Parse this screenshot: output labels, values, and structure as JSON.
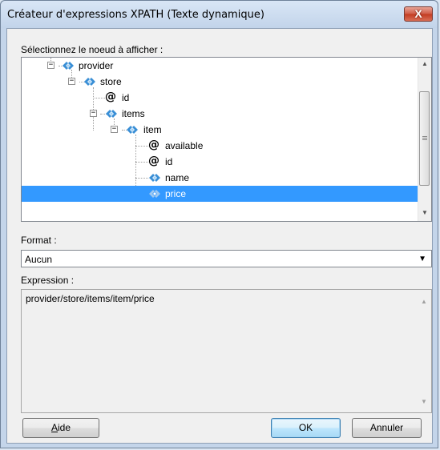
{
  "window": {
    "title": "Créateur d'expressions XPATH (Texte dynamique)",
    "close_glyph": "X"
  },
  "tree_section": {
    "label": "Sélectionnez le noeud à afficher :",
    "nodes": [
      {
        "label": "provider",
        "type": "element",
        "expander": "−"
      },
      {
        "label": "store",
        "type": "element",
        "expander": "−"
      },
      {
        "label": "id",
        "type": "attribute"
      },
      {
        "label": "items",
        "type": "element",
        "expander": "−"
      },
      {
        "label": "item",
        "type": "element",
        "expander": "−"
      },
      {
        "label": "available",
        "type": "attribute"
      },
      {
        "label": "id",
        "type": "attribute"
      },
      {
        "label": "name",
        "type": "element"
      },
      {
        "label": "price",
        "type": "element",
        "selected": true
      }
    ]
  },
  "format": {
    "label": "Format :",
    "selected": "Aucun"
  },
  "expression": {
    "label": "Expression :",
    "value": "provider/store/items/item/price"
  },
  "buttons": {
    "help_label": "Aide",
    "help_mnemonic": "A",
    "help_rest": "ide",
    "ok_label": "OK",
    "cancel_label": "Annuler"
  },
  "colors": {
    "selection": "#3399ff",
    "element_icon": "#3a8fd6"
  }
}
